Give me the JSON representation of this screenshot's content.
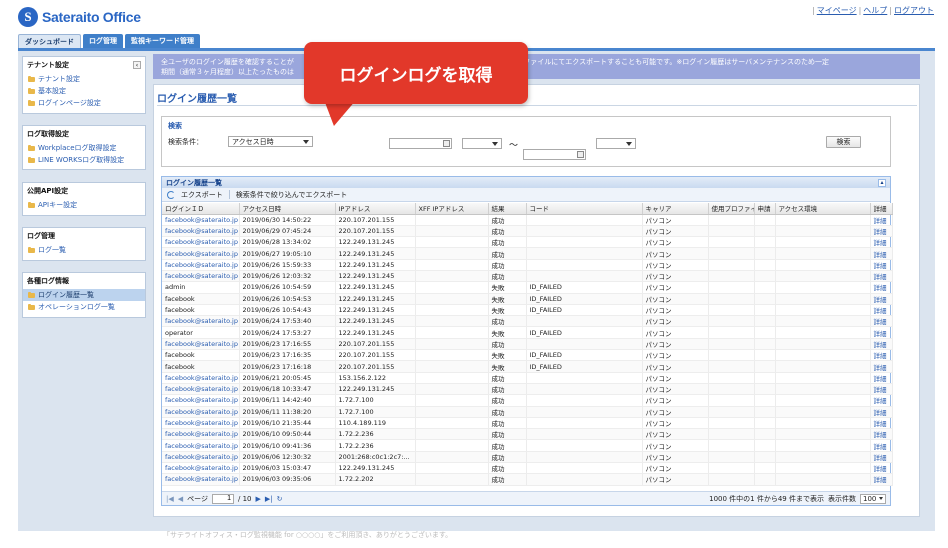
{
  "header": {
    "logo_letter": "S",
    "logo_text": "Sateraito Office",
    "links": [
      "マイページ",
      "ヘルプ",
      "ログアウト"
    ]
  },
  "tabs": [
    "ダッシュボード",
    "ログ管理",
    "監視キーワード管理"
  ],
  "sidebar": {
    "sections": [
      {
        "title": "テナント設定",
        "items": [
          "テナント設定",
          "基本設定",
          "ログインページ設定"
        ]
      },
      {
        "title": "ログ取得設定",
        "items": [
          "Workplaceログ取得設定",
          "LINE WORKSログ取得設定"
        ]
      },
      {
        "title": "公開API設定",
        "items": [
          "APIキー設定"
        ]
      },
      {
        "title": "ログ管理",
        "items": [
          "ログ一覧"
        ]
      },
      {
        "title": "各種ログ情報",
        "items": [
          "ログイン履歴一覧",
          "オペレーションログ一覧"
        ]
      }
    ]
  },
  "notice": {
    "line1_left": "全ユーザのログイン履歴を確認することが",
    "line1_right": "ただけます。またCSVファイルにてエクスポートすることも可能です。※ログイン履歴はサーバメンテナンスのため一定",
    "line2": "期間（通常３ヶ月程度）以上たったものは"
  },
  "page_title": "ログイン履歴一覧",
  "callout": "ログインログを取得",
  "search": {
    "title": "検索",
    "condition_label": "検索条件：",
    "condition_value": "アクセス日時",
    "range_sep": "〜",
    "button": "検索"
  },
  "grid": {
    "title": "ログイン履歴一覧",
    "toolbar": [
      "エクスポート",
      "検索条件で絞り込んでエクスポート"
    ],
    "columns": [
      "ログインＩＤ",
      "アクセス日時",
      "IPアドレス",
      "XFF IPアドレス",
      "結果",
      "コード",
      "キャリア",
      "使用プロファイル",
      "申請",
      "アクセス環境",
      "詳細"
    ],
    "rows": [
      [
        "facebook@sateraito.jp",
        "2019/06/30 14:50:22",
        "220.107.201.155",
        "",
        "成功",
        "",
        "パソコン",
        "詳細",
        true
      ],
      [
        "facebook@sateraito.jp",
        "2019/06/29 07:45:24",
        "220.107.201.155",
        "",
        "成功",
        "",
        "パソコン",
        "詳細",
        true
      ],
      [
        "facebook@sateraito.jp",
        "2019/06/28 13:34:02",
        "122.249.131.245",
        "",
        "成功",
        "",
        "パソコン",
        "詳細",
        true
      ],
      [
        "facebook@sateraito.jp",
        "2019/06/27 19:05:10",
        "122.249.131.245",
        "",
        "成功",
        "",
        "パソコン",
        "詳細",
        true
      ],
      [
        "facebook@sateraito.jp",
        "2019/06/26 15:59:33",
        "122.249.131.245",
        "",
        "成功",
        "",
        "パソコン",
        "詳細",
        true
      ],
      [
        "facebook@sateraito.jp",
        "2019/06/26 12:03:32",
        "122.249.131.245",
        "",
        "成功",
        "",
        "パソコン",
        "詳細",
        true
      ],
      [
        "admin",
        "2019/06/26 10:54:59",
        "122.249.131.245",
        "",
        "失敗",
        "ID_FAILED",
        "パソコン",
        "詳細",
        false
      ],
      [
        "facebook",
        "2019/06/26 10:54:53",
        "122.249.131.245",
        "",
        "失敗",
        "ID_FAILED",
        "パソコン",
        "詳細",
        false
      ],
      [
        "facebook",
        "2019/06/26 10:54:43",
        "122.249.131.245",
        "",
        "失敗",
        "ID_FAILED",
        "パソコン",
        "詳細",
        false
      ],
      [
        "facebook@sateraito.jp",
        "2019/06/24 17:53:40",
        "122.249.131.245",
        "",
        "成功",
        "",
        "パソコン",
        "詳細",
        true
      ],
      [
        "operator",
        "2019/06/24 17:53:27",
        "122.249.131.245",
        "",
        "失敗",
        "ID_FAILED",
        "パソコン",
        "詳細",
        false
      ],
      [
        "facebook@sateraito.jp",
        "2019/06/23 17:16:55",
        "220.107.201.155",
        "",
        "成功",
        "",
        "パソコン",
        "詳細",
        true
      ],
      [
        "facebook",
        "2019/06/23 17:16:35",
        "220.107.201.155",
        "",
        "失敗",
        "ID_FAILED",
        "パソコン",
        "詳細",
        false
      ],
      [
        "facebook",
        "2019/06/23 17:16:18",
        "220.107.201.155",
        "",
        "失敗",
        "ID_FAILED",
        "パソコン",
        "詳細",
        false
      ],
      [
        "facebook@sateraito.jp",
        "2019/06/21 20:05:45",
        "153.156.2.122",
        "",
        "成功",
        "",
        "パソコン",
        "詳細",
        true
      ],
      [
        "facebook@sateraito.jp",
        "2019/06/18 10:33:47",
        "122.249.131.245",
        "",
        "成功",
        "",
        "パソコン",
        "詳細",
        true
      ],
      [
        "facebook@sateraito.jp",
        "2019/06/11 14:42:40",
        "1.72.7.100",
        "",
        "成功",
        "",
        "パソコン",
        "詳細",
        true
      ],
      [
        "facebook@sateraito.jp",
        "2019/06/11 11:38:20",
        "1.72.7.100",
        "",
        "成功",
        "",
        "パソコン",
        "詳細",
        true
      ],
      [
        "facebook@sateraito.jp",
        "2019/06/10 21:35:44",
        "110.4.189.119",
        "",
        "成功",
        "",
        "パソコン",
        "詳細",
        true
      ],
      [
        "facebook@sateraito.jp",
        "2019/06/10 09:50:44",
        "1.72.2.236",
        "",
        "成功",
        "",
        "パソコン",
        "詳細",
        true
      ],
      [
        "facebook@sateraito.jp",
        "2019/06/10 09:41:36",
        "1.72.2.236",
        "",
        "成功",
        "",
        "パソコン",
        "詳細",
        true
      ],
      [
        "facebook@sateraito.jp",
        "2019/06/06 12:30:32",
        "2001:268:c0c1:2c7:...",
        "",
        "成功",
        "",
        "パソコン",
        "詳細",
        true
      ],
      [
        "facebook@sateraito.jp",
        "2019/06/03 15:03:47",
        "122.249.131.245",
        "",
        "成功",
        "",
        "パソコン",
        "詳細",
        true
      ],
      [
        "facebook@sateraito.jp",
        "2019/06/03 09:35:06",
        "1.72.2.202",
        "",
        "成功",
        "",
        "パソコン",
        "詳細",
        true
      ]
    ],
    "pager": {
      "page_label": "ページ",
      "page": "1",
      "of": "/ 10",
      "summary": "1000 件中の1 件から49 件まで表示",
      "per_page_label": "表示件数",
      "per_page": "100"
    }
  },
  "footer_note": "「サテライトオフィス・ログ監視機能 for ○○○○」をご利用頂き、ありがとうございます。"
}
